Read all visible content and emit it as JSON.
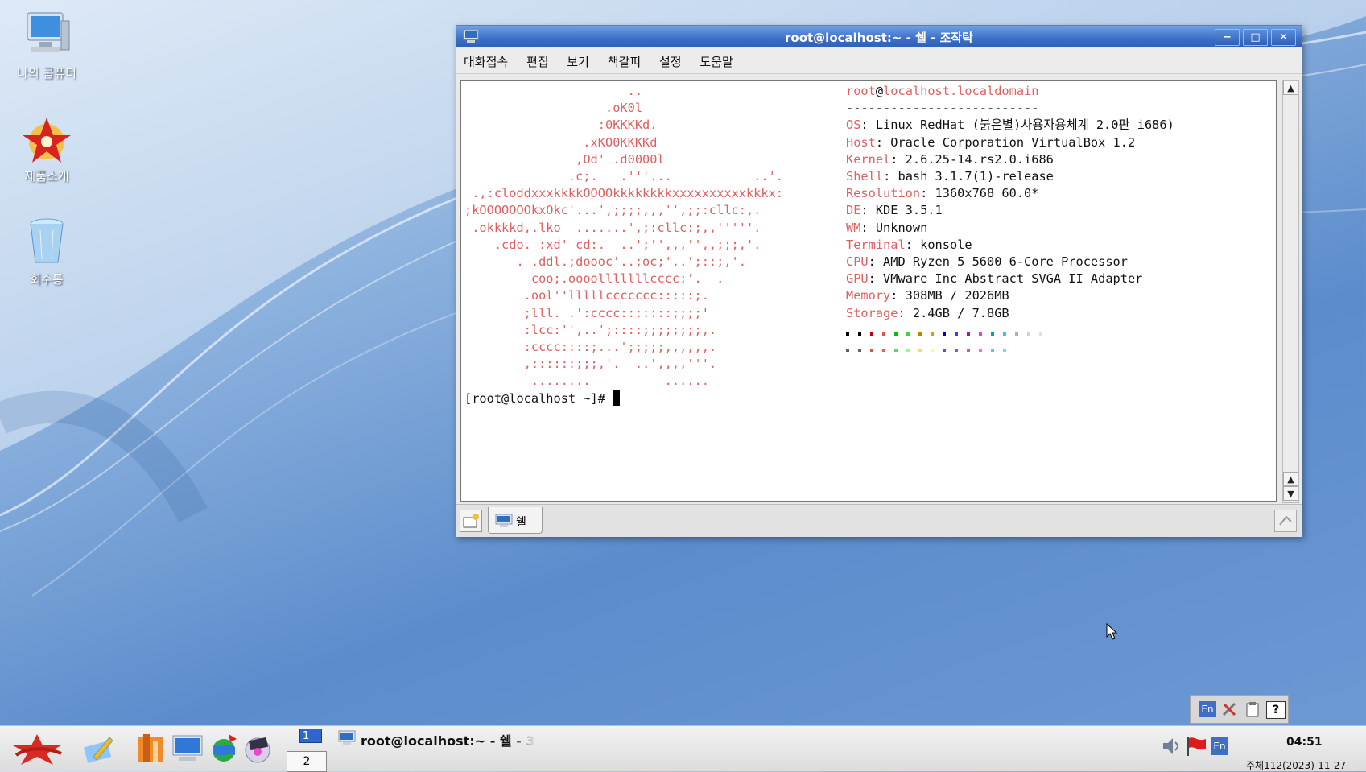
{
  "desktop": {
    "icons": [
      {
        "label": "나의 콤퓨터"
      },
      {
        "label": "제품소개"
      },
      {
        "label": "회수통"
      }
    ]
  },
  "window": {
    "title": "root@localhost:~ - 쉘 - 조작탁",
    "menu": [
      "대화접속",
      "편집",
      "보기",
      "책갈피",
      "설정",
      "도움말"
    ],
    "tab_label": "쉘"
  },
  "terminal": {
    "ascii_art": [
      "                      ..",
      "                   .oK0l",
      "                  :0KKKKd.",
      "                .xKO0KKKKd",
      "               ,Od' .d0000l",
      "              .c;.   .'''...           ..'.",
      " .,:cloddxxxkkkkOOOOkkkkkkkkxxxxxxxxxxkkkx:",
      ";kOOOOOOOkxOkc'...',;;;;,,,'',;;:cllc:,.",
      " .okkkkd,.lko  .......',;:cllc:;,,'''''.",
      "    .cdo. :xd' cd:.  ..';'',,,'',,;;;,'.",
      "       . .ddl.;doooc'..;oc;'..';::;,'.",
      "         coo;.oooolllllllcccc:'.  .",
      "        .ool''lllllccccccc:::::;.",
      "        ;lll. .':cccc:::::::;;;;'",
      "        :lcc:'',..';::::;;;;;;;;,.",
      "        :cccc::::;...';;;;;,,,,,,.",
      "        ,::::::;;;,'.  ..',,,,'''.",
      "         ........          ......"
    ],
    "info_header": {
      "user": "root",
      "at": "@",
      "host": "localhost.localdomain"
    },
    "separator": "--------------------------",
    "info": [
      {
        "key": "OS",
        "value": "Linux RedHat (붉은별)사용자용체계 2.0판 i686)"
      },
      {
        "key": "Host",
        "value": "Oracle Corporation VirtualBox 1.2"
      },
      {
        "key": "Kernel",
        "value": "2.6.25-14.rs2.0.i686"
      },
      {
        "key": "Shell",
        "value": "bash 3.1.7(1)-release"
      },
      {
        "key": "Resolution",
        "value": "1360x768 60.0*"
      },
      {
        "key": "DE",
        "value": "KDE 3.5.1"
      },
      {
        "key": "WM",
        "value": "Unknown"
      },
      {
        "key": "Terminal",
        "value": "konsole"
      },
      {
        "key": "CPU",
        "value": "AMD Ryzen 5 5600 6-Core Processor"
      },
      {
        "key": "GPU",
        "value": "VMware Inc Abstract SVGA II Adapter"
      },
      {
        "key": "Memory",
        "value": "308MB / 2026MB"
      },
      {
        "key": "Storage",
        "value": "2.4GB / 7.8GB"
      }
    ],
    "palette_row1": [
      "#000000",
      "#000000",
      "#c00000",
      "#e05050",
      "#00c000",
      "#40d040",
      "#c08000",
      "#d0a000",
      "#0000c0",
      "#4040e0",
      "#c000c0",
      "#e040e0",
      "#00a0c0",
      "#40c0e0",
      "#b0b0b0",
      "#d0d0d0",
      "#e0e0e0"
    ],
    "palette_row2": [
      "#606060",
      "#606060",
      "#e05050",
      "#ff5050",
      "#50e050",
      "#a0ff60",
      "#f0e050",
      "#ffff60",
      "#5050f0",
      "#6060ff",
      "#d050d0",
      "#ff60ff",
      "#50d0e0",
      "#60e0ff"
    ],
    "prompt": "[root@localhost ~]# "
  },
  "taskbar": {
    "desktops": [
      "1",
      "2"
    ],
    "task_label": "root@localhost:~ - 쉘 - 3",
    "time": "04:51",
    "date": "주체112(2023)-11-27"
  },
  "tray": {
    "input_lang": "En"
  },
  "colors": {
    "title_blue": "#3c6fc8",
    "term_red": "#e06060"
  }
}
